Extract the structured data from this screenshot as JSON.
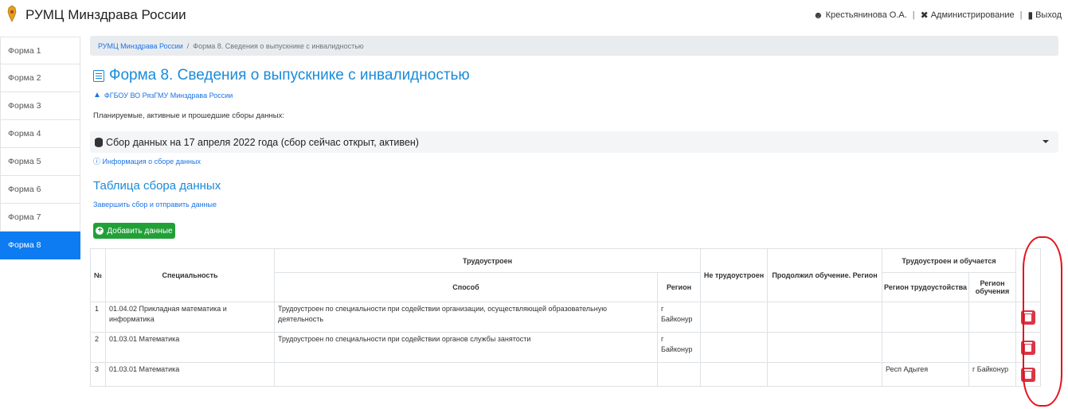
{
  "app": {
    "title": "РУМЦ Минздрава России",
    "user": "Крестьянинова О.А.",
    "admin": "Администрирование",
    "logout": "Выход",
    "separator": "|"
  },
  "sidebar": {
    "items": [
      {
        "label": "Форма 1",
        "active": false
      },
      {
        "label": "Форма 2",
        "active": false
      },
      {
        "label": "Форма 3",
        "active": false
      },
      {
        "label": "Форма 4",
        "active": false
      },
      {
        "label": "Форма 5",
        "active": false
      },
      {
        "label": "Форма 6",
        "active": false
      },
      {
        "label": "Форма 7",
        "active": false
      },
      {
        "label": "Форма 8",
        "active": true
      }
    ]
  },
  "breadcrumb": {
    "root": "РУМЦ Минздрава России",
    "divider": "/",
    "current": "Форма 8. Сведения о выпускнике с инвалидностью"
  },
  "page": {
    "title": "Форма 8. Сведения о выпускнике с инвалидностью",
    "org": "ФГБОУ ВО РязГМУ Минздрава России",
    "planned_label": "Планируемые, активные и прошедшие сборы данных:",
    "collection_select": "Сбор данных на 17 апреля 2022 года (сбор сейчас открыт, активен)",
    "info_link": "Информация о сборе данных",
    "section_title": "Таблица сбора данных",
    "finish_link": "Завершить сбор и отправить данные",
    "add_button": "Добавить данные"
  },
  "table": {
    "headers": {
      "num": "№",
      "specialty": "Специальность",
      "employed": "Трудоустроен",
      "method": "Способ",
      "region": "Регион",
      "not_employed": "Не трудоустроен",
      "continued": "Продолжил обучение. Регион",
      "employed_studying": "Трудоустроен и обучается",
      "work_region": "Регион трудоустойства",
      "study_region": "Регион обучения"
    },
    "rows": [
      {
        "num": "1",
        "specialty": "01.04.02 Прикладная математика и информатика",
        "method": "Трудоустроен по специальности при содействии организации, осуществляющей образовательную деятельность",
        "region": "г Байконур",
        "not_employed": "",
        "continued": "",
        "work_region": "",
        "study_region": ""
      },
      {
        "num": "2",
        "specialty": "01.03.01 Математика",
        "method": "Трудоустроен по специальности при содействии органов службы занятости",
        "region": "г Байконур",
        "not_employed": "",
        "continued": "",
        "work_region": "",
        "study_region": ""
      },
      {
        "num": "3",
        "specialty": "01.03.01 Математика",
        "method": "",
        "region": "",
        "not_employed": "",
        "continued": "",
        "work_region": "Респ Адыгея",
        "study_region": "г Байконур"
      }
    ]
  },
  "colors": {
    "accent": "#1a8bd9",
    "active_sidebar": "#0d7bf1",
    "add_button": "#22a038",
    "delete_button": "#dc3545",
    "annotation": "#e3131b"
  },
  "icons": {
    "emblem": "emblem-icon",
    "users": "users-icon",
    "admin": "tools-icon",
    "logout": "logout-icon",
    "doc": "document-icon",
    "cap": "graduation-cap-icon",
    "db": "database-icon",
    "info": "question-circle-icon",
    "plus": "plus-circle-icon",
    "trash": "trash-icon"
  }
}
